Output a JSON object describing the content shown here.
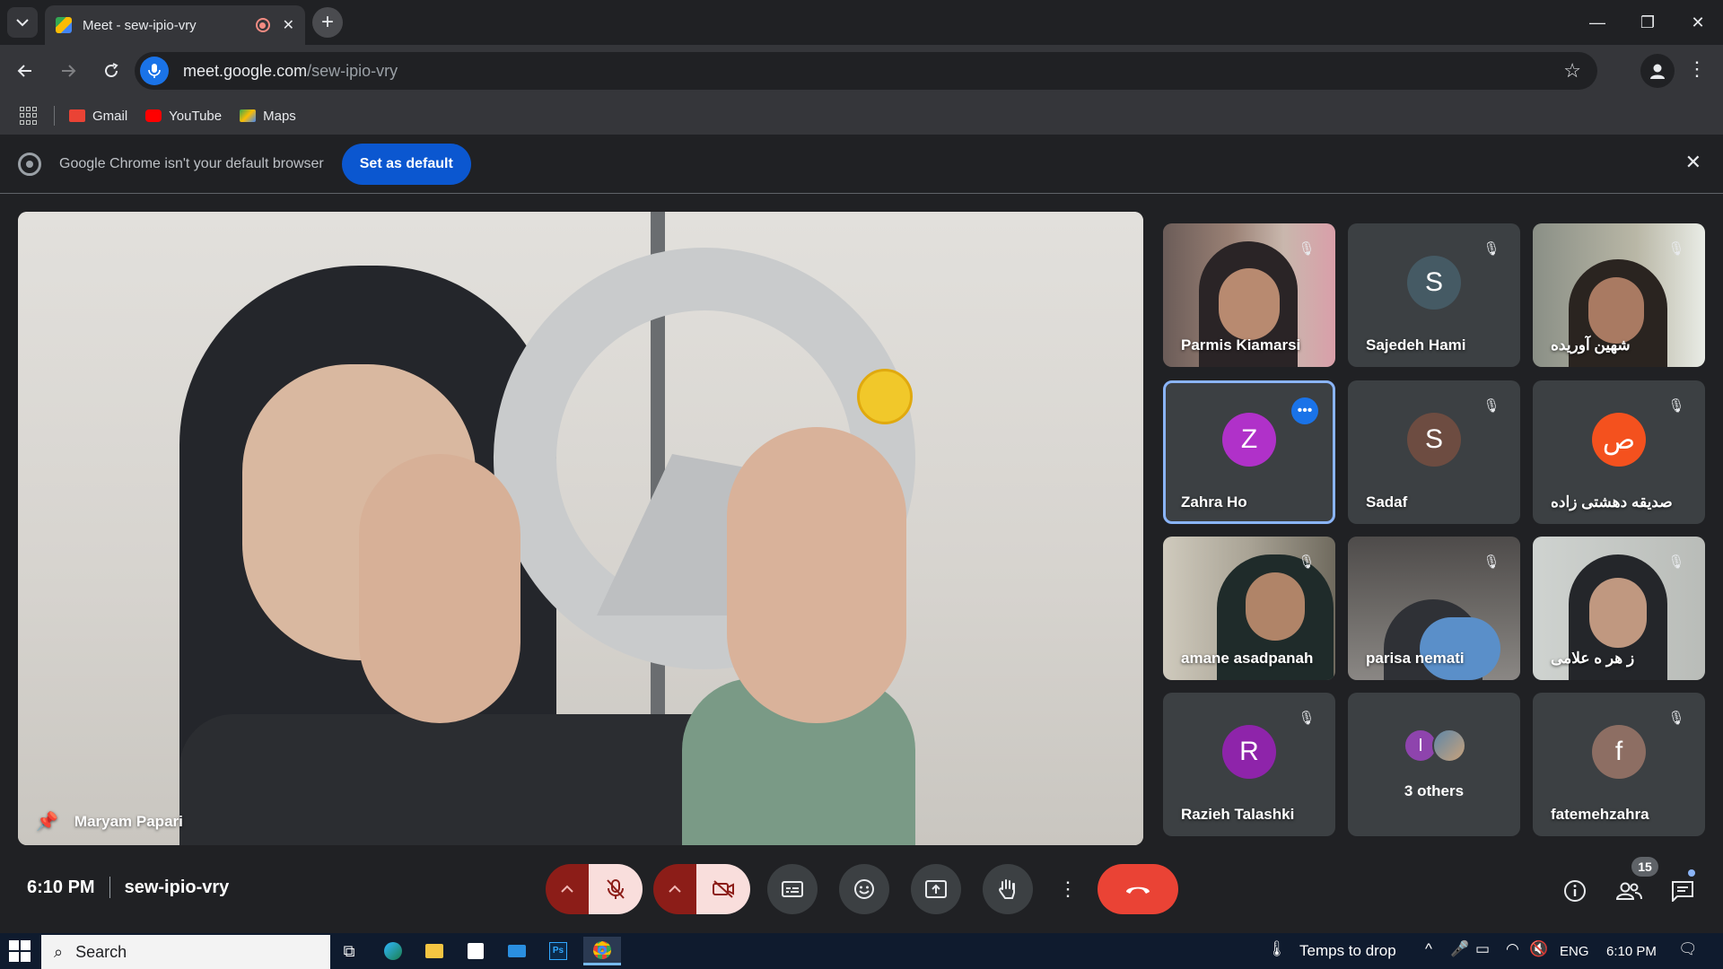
{
  "browser": {
    "tab_title": "Meet - sew-ipio-vry",
    "url_host": "meet.google.com",
    "url_path": "/sew-ipio-vry",
    "bookmarks": [
      {
        "label": "Gmail",
        "color": "#ea4335"
      },
      {
        "label": "YouTube",
        "color": "#ff0000"
      },
      {
        "label": "Maps",
        "color": "#34a853"
      }
    ],
    "infobar_text": "Google Chrome isn't your default browser",
    "infobar_button": "Set as default"
  },
  "meet": {
    "main_speaker": "Maryam Papari",
    "participants": [
      {
        "name": "Parmis Kiamarsi",
        "type": "video",
        "muted": true
      },
      {
        "name": "Sajedeh Hami",
        "type": "avatar",
        "initial": "S",
        "color": "#455a64",
        "muted": true
      },
      {
        "name": "شهین آوریده",
        "type": "video",
        "muted": true
      },
      {
        "name": "Zahra Ho",
        "type": "avatar",
        "initial": "Z",
        "color": "#b031c9",
        "muted": false,
        "active": true
      },
      {
        "name": "Sadaf",
        "type": "avatar",
        "initial": "S",
        "color": "#6d4c41",
        "muted": true
      },
      {
        "name": "صدیقه دهشتی زاده",
        "type": "avatar",
        "initial": "ص",
        "color": "#f4511e",
        "muted": true
      },
      {
        "name": "amane asadpanah",
        "type": "video",
        "muted": true
      },
      {
        "name": "parisa nemati",
        "type": "video",
        "muted": true
      },
      {
        "name": "ز هر ه علامی",
        "type": "video",
        "muted": true
      },
      {
        "name": "Razieh Talashki",
        "type": "avatar",
        "initial": "R",
        "color": "#8e24aa",
        "muted": true
      },
      {
        "name": "3 others",
        "type": "others",
        "initial": "I",
        "muted": false
      },
      {
        "name": "fatemehzahra",
        "type": "avatar",
        "initial": "f",
        "color": "#8d6e63",
        "muted": true
      }
    ],
    "time": "6:10 PM",
    "meeting_code": "sew-ipio-vry",
    "people_count": "15"
  },
  "taskbar": {
    "search_placeholder": "Search",
    "weather": "Temps to drop",
    "language": "ENG",
    "clock": "6:10 PM"
  }
}
